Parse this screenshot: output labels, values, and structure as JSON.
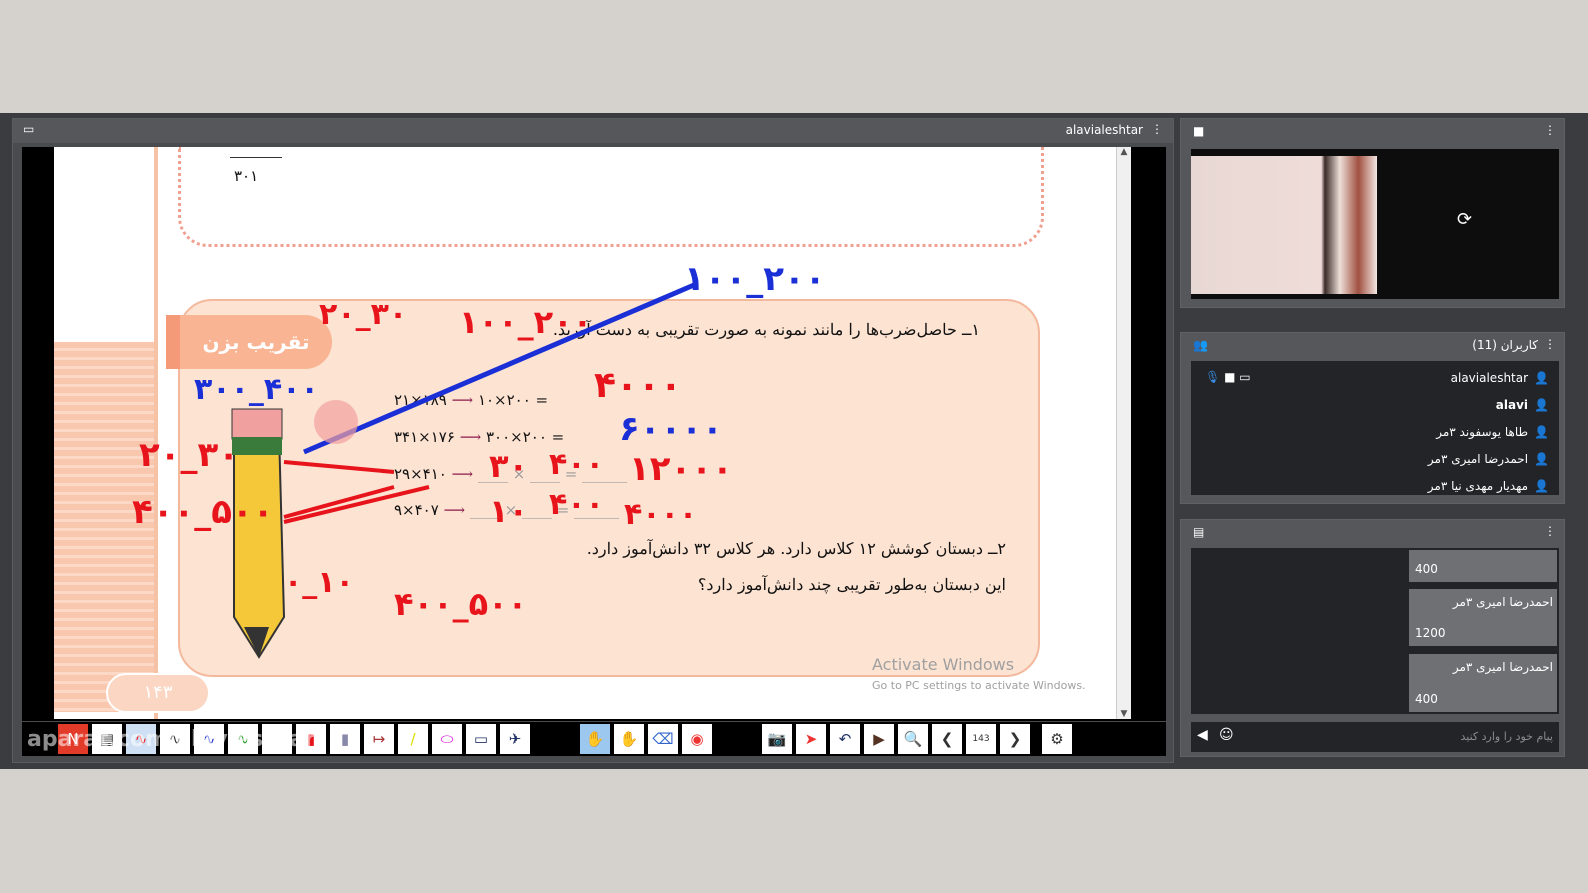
{
  "presentation": {
    "title": "alavialeshtar",
    "menu_icon": "kebab-menu-icon",
    "screen_icon": "monitor-icon"
  },
  "slide": {
    "top_number": "۳۰۱",
    "tag": "تقریب بزن",
    "q1": "۱ــ حاصل‌ضرب‌ها را مانند نمونه به صورت تقریبی به دست آورید.",
    "rows": [
      {
        "left": "۲۱×۱۸۹",
        "right": "۱۰×۲۰۰ ="
      },
      {
        "left": "۳۴۱×۱۷۶",
        "right": "۳۰۰×۲۰۰ ="
      },
      {
        "left": "۲۹×۴۱۰",
        "right": "____ × ____ = ______"
      },
      {
        "left": "۹×۴۰۷",
        "right": "____ × ____ = ______"
      }
    ],
    "q2a": "۲ــ دبستان کوشش ۱۲ کلاس دارد. هر کلاس ۳۲ دانش‌آموز دارد.",
    "q2b": "این دبستان به‌طور تقریبی چند دانش‌آموز دارد؟",
    "page": "۱۴۳",
    "activate_title": "Activate Windows",
    "activate_sub": "Go to PC settings to activate Windows.",
    "ink": {
      "a": "۱۰۰_۲۰۰",
      "b": "۲۰_۳۰",
      "c": "۱۰۰_۲۰۰",
      "d": "۳۰۰_۴۰۰",
      "e": "۴۰۰۰",
      "f": "۶۰۰۰۰",
      "g": "۲۰_۳۰",
      "h": "۳۰",
      "i": "۴۰۰",
      "j": "۱۲۰۰۰",
      "k": "۴۰۰_۵۰۰",
      "l": "۱۰",
      "m": "۴۰۰",
      "n": "۴۰۰۰",
      "o": "۰_۱۰",
      "p": "۴۰۰_۵۰۰"
    }
  },
  "toolbar": {
    "page_number": "143",
    "watermark": "aparat.com/alavieshtar",
    "colors": {
      "red": "#e8141c",
      "blue": "#1a2fd6"
    }
  },
  "video": {
    "camera_icon": "video-camera-icon",
    "refresh_icon": "refresh-icon"
  },
  "users": {
    "title": "کاربران (11)",
    "list": [
      {
        "name": "alavialeshtar"
      },
      {
        "name": "alavi"
      },
      {
        "name": "طاها یوسفوند ۳مر"
      },
      {
        "name": "احمدرضا امیری ۳مر"
      },
      {
        "name": "مهدیار مهدی نیا ۳مر"
      }
    ]
  },
  "chat": {
    "messages": [
      {
        "sender": "",
        "text": "400"
      },
      {
        "sender": "احمدرضا امیری ۳مر",
        "text": "1200"
      },
      {
        "sender": "احمدرضا امیری ۳مر",
        "text": "400"
      }
    ],
    "placeholder": "پیام خود را وارد کنید"
  }
}
